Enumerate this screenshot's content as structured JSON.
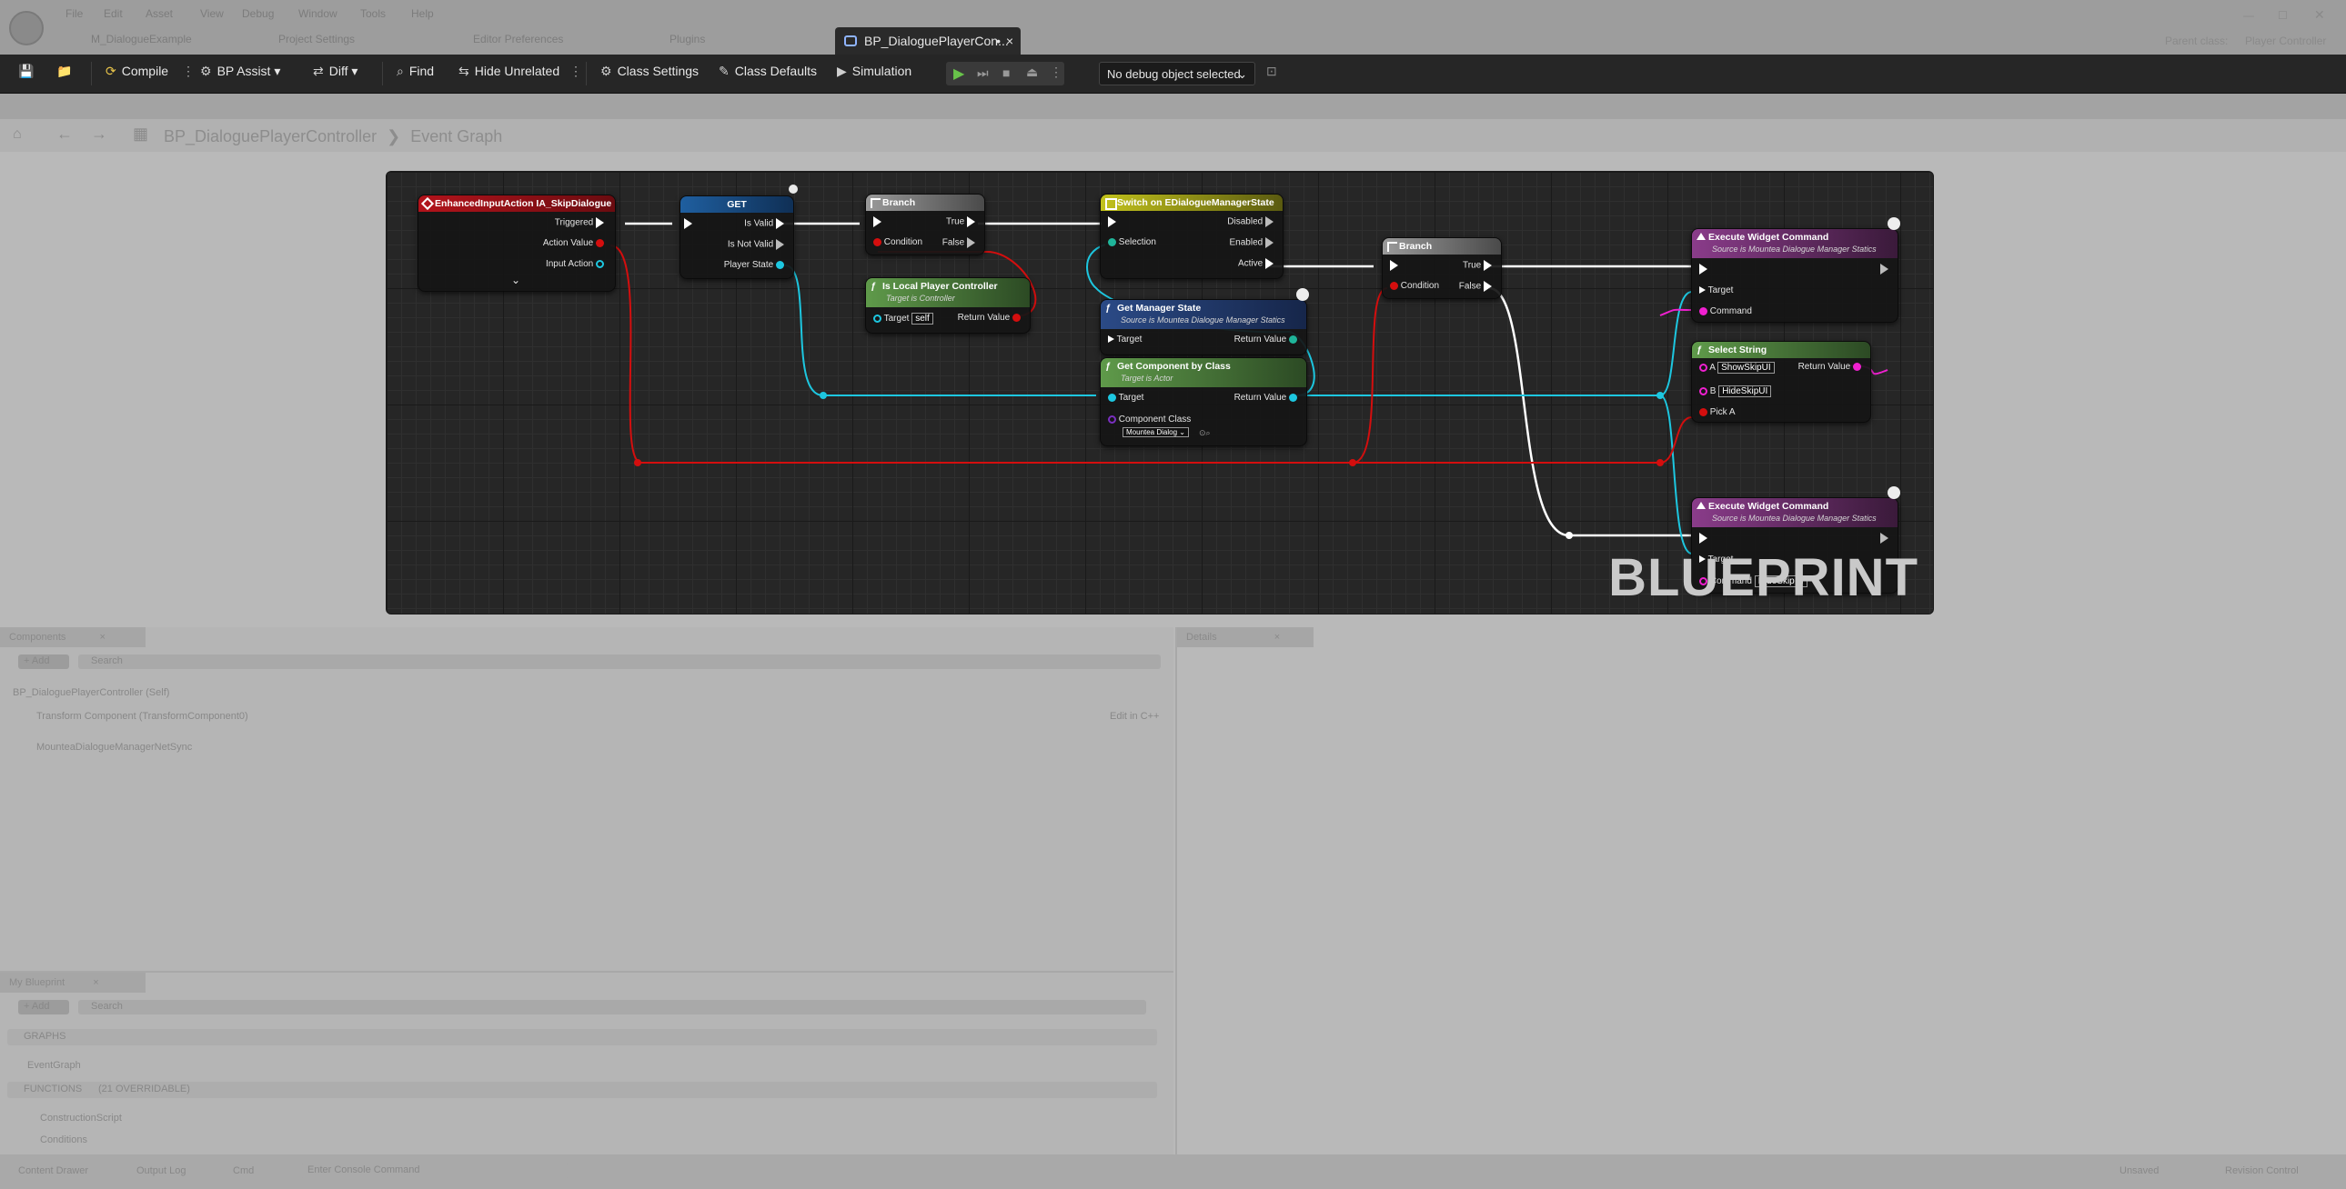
{
  "menu": [
    "File",
    "Edit",
    "Asset",
    "View",
    "Debug",
    "Window",
    "Tools",
    "Help"
  ],
  "tabs": {
    "inactive": [
      "M_DialogueExample",
      "Project Settings",
      "Editor Preferences",
      "Plugins"
    ],
    "active": "BP_DialoguePlayerCon...",
    "active_modified": "•",
    "close": "×"
  },
  "header_right": {
    "parent_label": "Parent class:",
    "parent_value": "Player Controller"
  },
  "toolbar": {
    "compile": "Compile",
    "bp_assist": "BP Assist",
    "diff": "Diff",
    "find": "Find",
    "hide_unrelated": "Hide Unrelated",
    "class_settings": "Class Settings",
    "class_defaults": "Class Defaults",
    "simulation": "Simulation",
    "debug_select": "No debug object selected"
  },
  "breadcrumb": {
    "blueprint": "BP_DialoguePlayerController",
    "separator": "❯",
    "graph": "Event Graph"
  },
  "graph": {
    "watermark": "BLUEPRINT",
    "nodes": {
      "input": {
        "title": "EnhancedInputAction IA_SkipDialogue",
        "pins": [
          "Triggered",
          "Action Value",
          "Input Action"
        ]
      },
      "get": {
        "title": "GET",
        "pins": [
          "Is Valid",
          "Is Not Valid",
          "Player State"
        ]
      },
      "branch1": {
        "title": "Branch",
        "pins": [
          "True",
          "Condition",
          "False"
        ]
      },
      "is_local": {
        "title": "Is Local Player Controller",
        "subtitle": "Target is Controller",
        "target": "Target",
        "self": "self",
        "ret": "Return Value"
      },
      "switch": {
        "title": "Switch on EDialogueManagerState",
        "pins": [
          "Selection",
          "Disabled",
          "Enabled",
          "Active"
        ]
      },
      "get_manager": {
        "title": "Get Manager State",
        "subtitle": "Source is Mountea Dialogue Manager Statics",
        "target": "Target",
        "ret": "Return Value"
      },
      "get_component": {
        "title": "Get Component by Class",
        "subtitle": "Target is Actor",
        "target": "Target",
        "ret": "Return Value",
        "class_label": "Component Class",
        "class_value": "Mountea Dialog"
      },
      "branch2": {
        "title": "Branch",
        "pins": [
          "True",
          "Condition",
          "False"
        ]
      },
      "exec1": {
        "title": "Execute Widget Command",
        "subtitle": "Source is Mountea Dialogue Manager Statics",
        "target": "Target",
        "command": "Command"
      },
      "select": {
        "title": "Select String",
        "a": "A",
        "a_val": "ShowSkipUI",
        "b": "B",
        "b_val": "HideSkipUI",
        "pick": "Pick A",
        "ret": "Return Value"
      },
      "exec2": {
        "title": "Execute Widget Command",
        "subtitle": "Source is Mountea Dialogue Manager Statics",
        "target": "Target",
        "command": "Command",
        "command_val": "HideSkipUI"
      }
    }
  },
  "components_panel": {
    "title": "Components",
    "add": "+ Add",
    "search": "Search",
    "root": "BP_DialoguePlayerController (Self)",
    "items": [
      "Transform Component (TransformComponent0)",
      "MounteaDialogueManagerNetSync"
    ],
    "item_right": "Edit in C++"
  },
  "details_panel": {
    "title": "Details"
  },
  "my_blueprint": {
    "title": "My Blueprint",
    "add": "+ Add",
    "search": "Search",
    "graphs": "GRAPHS",
    "event_graph": "EventGraph",
    "functions": "FUNCTIONS",
    "functions_extra": "(21 OVERRIDABLE)",
    "fn1": "ConstructionScript",
    "fn2": "Conditions"
  },
  "statusbar": {
    "content_drawer": "Content Drawer",
    "output_log": "Output Log",
    "cmd": "Cmd",
    "cmd_placeholder": "Enter Console Command",
    "right1": "Unsaved",
    "right2": "Revision Control"
  }
}
